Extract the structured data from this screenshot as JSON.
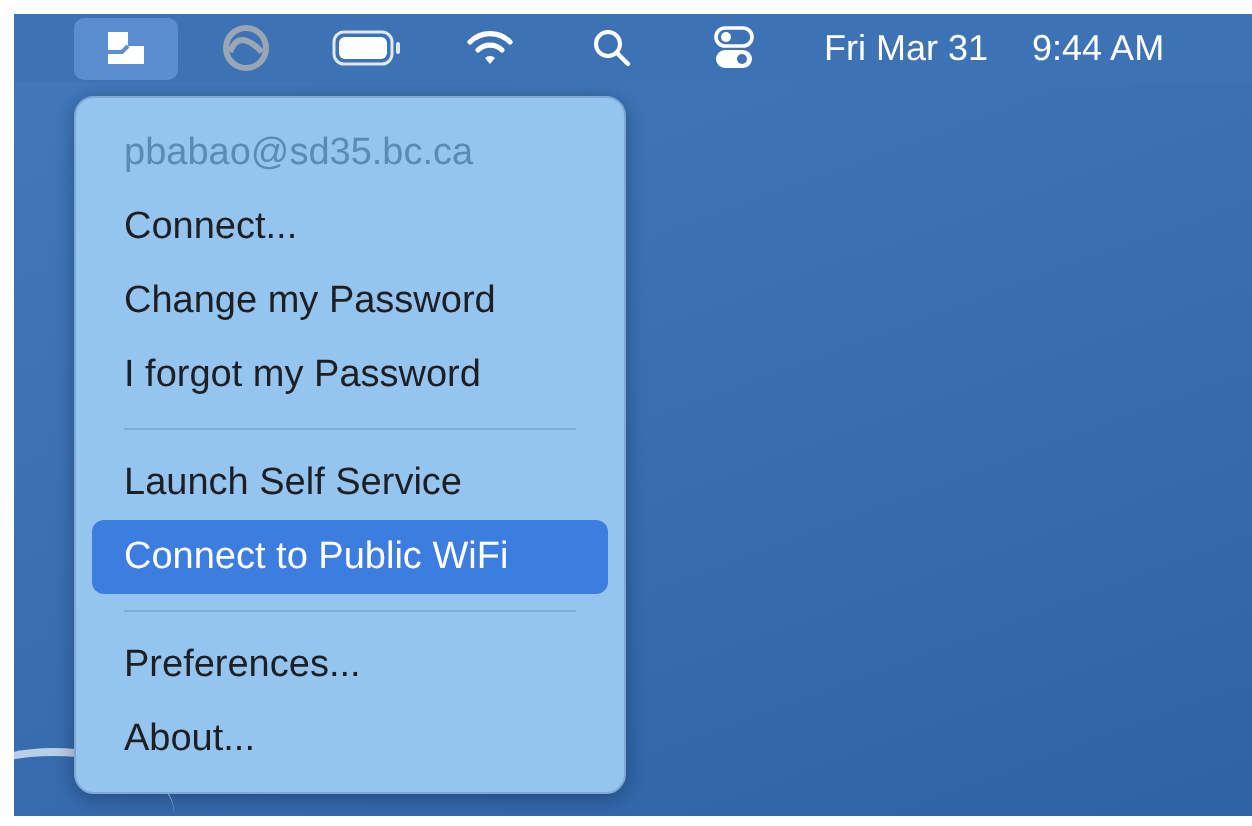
{
  "menu_bar": {
    "status_icons": [
      {
        "kind": "app",
        "selected": true
      },
      {
        "kind": "cloud",
        "selected": false
      },
      {
        "kind": "battery",
        "selected": false
      },
      {
        "kind": "wifi",
        "selected": false
      },
      {
        "kind": "search",
        "selected": false
      },
      {
        "kind": "control",
        "selected": false
      }
    ],
    "date": "Fri Mar 31",
    "time": "9:44 AM"
  },
  "menu": {
    "items": [
      {
        "kind": "header",
        "label": "pbabao@sd35.bc.ca",
        "disabled": true,
        "selected": false
      },
      {
        "kind": "item",
        "label": "Connect...",
        "disabled": false,
        "selected": false
      },
      {
        "kind": "item",
        "label": "Change my Password",
        "disabled": false,
        "selected": false
      },
      {
        "kind": "item",
        "label": "I forgot my Password",
        "disabled": false,
        "selected": false
      },
      {
        "kind": "separator"
      },
      {
        "kind": "item",
        "label": "Launch Self Service",
        "disabled": false,
        "selected": false
      },
      {
        "kind": "item",
        "label": "Connect to Public WiFi",
        "disabled": false,
        "selected": true
      },
      {
        "kind": "separator"
      },
      {
        "kind": "item",
        "label": "Preferences...",
        "disabled": false,
        "selected": false
      },
      {
        "kind": "item",
        "label": "About...",
        "disabled": false,
        "selected": false
      }
    ]
  }
}
